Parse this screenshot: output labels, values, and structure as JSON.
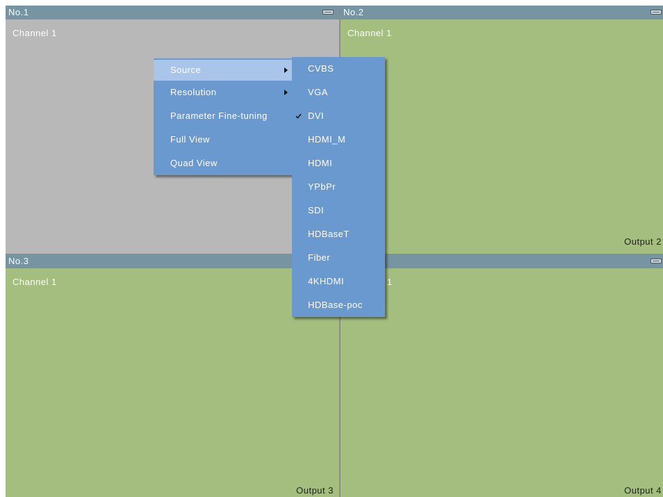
{
  "colors": {
    "header_bar": "#7794a3",
    "panel_inactive": "#b8b8b8",
    "panel_active": "#a3be7e",
    "menu": "#6a99d0",
    "menu_highlight": "#a9c6ea",
    "divider": "#8c8c8c"
  },
  "icons": {
    "panel_header": "window-grip-icon",
    "submenu_arrow": "submenu-arrow-icon",
    "selected_check": "checkmark-icon"
  },
  "panels": [
    {
      "title": "No.1",
      "channel": "Channel 1",
      "background": "#b8b8b8"
    },
    {
      "title": "No.2",
      "channel": "Channel 1",
      "output": "Output 2",
      "background": "#a3be7e"
    },
    {
      "title": "No.3",
      "channel": "Channel 1",
      "output": "Output 3",
      "background": "#a3be7e"
    },
    {
      "channel": "Channel 1",
      "output": "Output 4",
      "background": "#a3be7e"
    }
  ],
  "context_menu": {
    "items": [
      {
        "label": "Source",
        "has_submenu": true,
        "highlighted": true
      },
      {
        "label": "Resolution",
        "has_submenu": true,
        "highlighted": false
      },
      {
        "label": "Parameter Fine-tuning",
        "has_submenu": false,
        "highlighted": false
      },
      {
        "label": "Full View",
        "has_submenu": false,
        "highlighted": false
      },
      {
        "label": "Quad View",
        "has_submenu": false,
        "highlighted": false
      }
    ]
  },
  "source_submenu": {
    "items": [
      {
        "label": "CVBS",
        "checked": false
      },
      {
        "label": "VGA",
        "checked": false
      },
      {
        "label": "DVI",
        "checked": true
      },
      {
        "label": "HDMI_M",
        "checked": false
      },
      {
        "label": "HDMI",
        "checked": false
      },
      {
        "label": "YPbPr",
        "checked": false
      },
      {
        "label": "SDI",
        "checked": false
      },
      {
        "label": "HDBaseT",
        "checked": false
      },
      {
        "label": "Fiber",
        "checked": false
      },
      {
        "label": "4KHDMI",
        "checked": false
      },
      {
        "label": "HDBase-poc",
        "checked": false
      }
    ]
  }
}
